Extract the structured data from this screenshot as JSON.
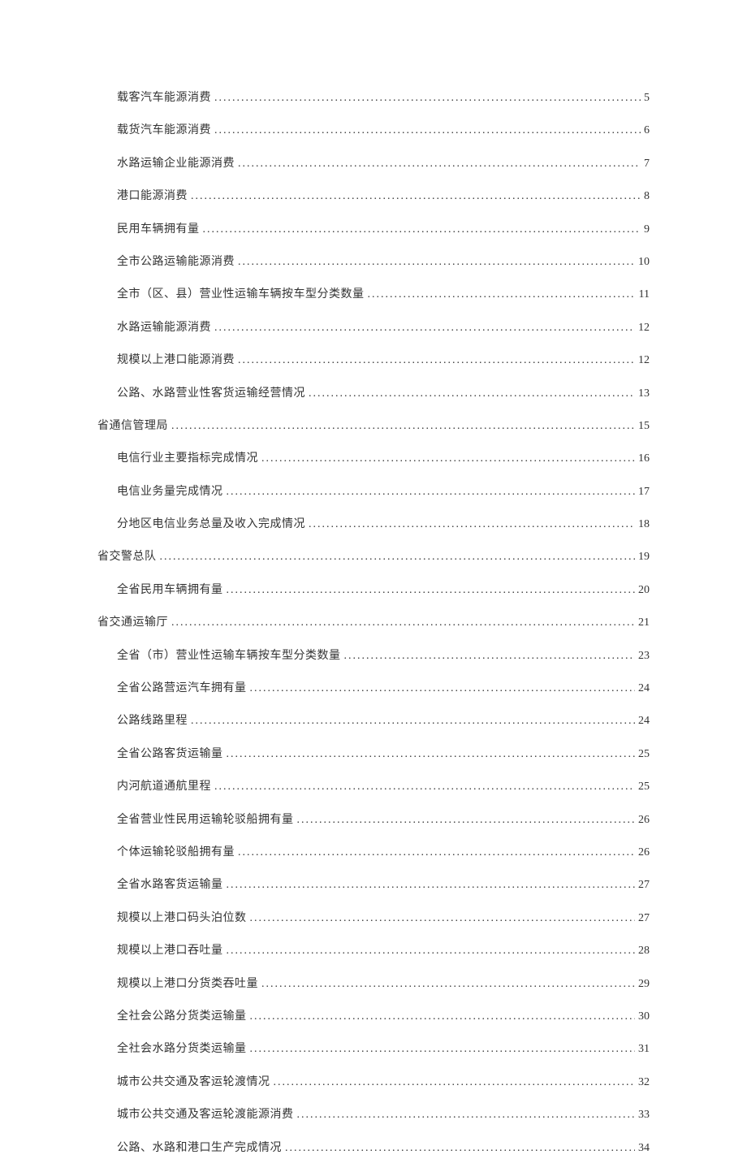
{
  "toc": [
    {
      "level": 2,
      "label": "载客汽车能源消费",
      "page": "5"
    },
    {
      "level": 2,
      "label": "载货汽车能源消费",
      "page": "6"
    },
    {
      "level": 2,
      "label": "水路运输企业能源消费",
      "page": "7"
    },
    {
      "level": 2,
      "label": "港口能源消费",
      "page": "8"
    },
    {
      "level": 2,
      "label": "民用车辆拥有量",
      "page": "9"
    },
    {
      "level": 2,
      "label": "全市公路运输能源消费",
      "page": "10"
    },
    {
      "level": 2,
      "label": "全市（区、县）营业性运输车辆按车型分类数量",
      "page": "11"
    },
    {
      "level": 2,
      "label": "水路运输能源消费",
      "page": "12"
    },
    {
      "level": 2,
      "label": "规模以上港口能源消费",
      "page": "12"
    },
    {
      "level": 2,
      "label": "公路、水路营业性客货运输经营情况",
      "page": "13"
    },
    {
      "level": 1,
      "label": "省通信管理局",
      "page": "15"
    },
    {
      "level": 2,
      "label": "电信行业主要指标完成情况",
      "page": "16"
    },
    {
      "level": 2,
      "label": "电信业务量完成情况",
      "page": "17"
    },
    {
      "level": 2,
      "label": "分地区电信业务总量及收入完成情况",
      "page": "18"
    },
    {
      "level": 1,
      "label": "省交警总队",
      "page": "19"
    },
    {
      "level": 2,
      "label": "全省民用车辆拥有量",
      "page": "20"
    },
    {
      "level": 1,
      "label": "省交通运输厅",
      "page": "21"
    },
    {
      "level": 2,
      "label": "全省（市）营业性运输车辆按车型分类数量",
      "page": "23"
    },
    {
      "level": 2,
      "label": "全省公路营运汽车拥有量",
      "page": "24"
    },
    {
      "level": 2,
      "label": "公路线路里程",
      "page": "24"
    },
    {
      "level": 2,
      "label": "全省公路客货运输量",
      "page": "25"
    },
    {
      "level": 2,
      "label": "内河航道通航里程",
      "page": "25"
    },
    {
      "level": 2,
      "label": "全省营业性民用运输轮驳船拥有量",
      "page": "26"
    },
    {
      "level": 2,
      "label": "个体运输轮驳船拥有量",
      "page": "26"
    },
    {
      "level": 2,
      "label": "全省水路客货运输量",
      "page": "27"
    },
    {
      "level": 2,
      "label": "规模以上港口码头泊位数",
      "page": "27"
    },
    {
      "level": 2,
      "label": "规模以上港口吞吐量",
      "page": "28"
    },
    {
      "level": 2,
      "label": "规模以上港口分货类吞吐量",
      "page": "29"
    },
    {
      "level": 2,
      "label": "全社会公路分货类运输量",
      "page": "30"
    },
    {
      "level": 2,
      "label": "全社会水路分货类运输量",
      "page": "31"
    },
    {
      "level": 2,
      "label": "城市公共交通及客运轮渡情况",
      "page": "32"
    },
    {
      "level": 2,
      "label": "城市公共交通及客运轮渡能源消费",
      "page": "33"
    },
    {
      "level": 2,
      "label": "公路、水路和港口生产完成情况",
      "page": "34"
    }
  ]
}
